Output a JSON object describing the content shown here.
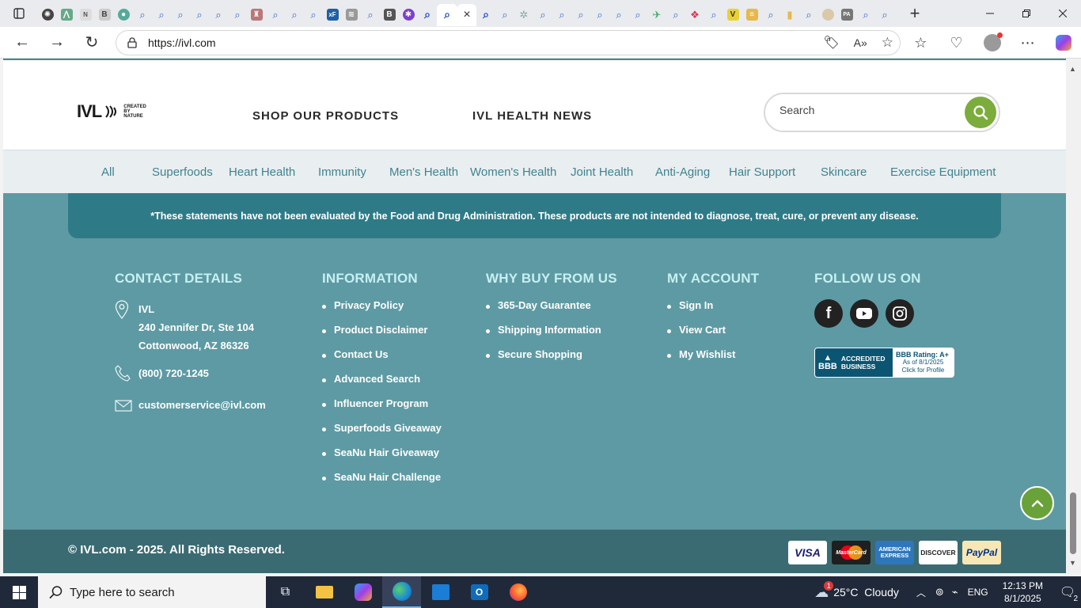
{
  "browser": {
    "url": "https://ivl.com",
    "new_tab_label": "+",
    "close_tab_label": "×",
    "tab_glyphs": [
      "N",
      "B",
      "xF",
      "B",
      "V",
      "PA"
    ]
  },
  "header": {
    "logo_main": "IVL",
    "logo_sub_1": "CREATED",
    "logo_sub_2": "BY",
    "logo_sub_3": "NATURE",
    "nav": [
      "SHOP OUR PRODUCTS",
      "IVL HEALTH NEWS"
    ],
    "search_placeholder": "Search"
  },
  "categories": [
    "All",
    "Superfoods",
    "Heart Health",
    "Immunity",
    "Men's Health",
    "Women's Health",
    "Joint Health",
    "Anti-Aging",
    "Hair Support",
    "Skincare",
    "Exercise Equipment"
  ],
  "footer": {
    "disclaimer": "*These statements have not been evaluated by the Food and Drug Administration. These products are not intended to diagnose, treat, cure, or prevent any disease.",
    "contact": {
      "title": "CONTACT DETAILS",
      "company": "IVL",
      "address_1": "240 Jennifer Dr, Ste 104",
      "address_2": "Cottonwood, AZ 86326",
      "phone": "(800) 720-1245",
      "email": "customerservice@ivl.com"
    },
    "information": {
      "title": "INFORMATION",
      "items": [
        "Privacy Policy",
        "Product Disclaimer",
        "Contact Us",
        "Advanced Search",
        "Influencer Program",
        "Superfoods Giveaway",
        "SeaNu Hair Giveaway",
        "SeaNu Hair Challenge"
      ]
    },
    "why_buy": {
      "title": "WHY BUY FROM US",
      "items": [
        "365-Day Guarantee",
        "Shipping Information",
        "Secure Shopping"
      ]
    },
    "account": {
      "title": "MY ACCOUNT",
      "items": [
        "Sign In",
        "View Cart",
        "My Wishlist"
      ]
    },
    "follow": {
      "title": "FOLLOW US ON",
      "bbb_left_1": "ACCREDITED",
      "bbb_left_2": "BUSINESS",
      "bbb_rating": "BBB Rating: A+",
      "bbb_date": "As of 8/1/2025",
      "bbb_click": "Click for Profile"
    },
    "copyright": "© IVL.com - 2025. All Rights Reserved.",
    "payments": [
      "VISA",
      "MasterCard",
      "AMERICAN EXPRESS",
      "DISCOVER",
      "PayPal"
    ]
  },
  "taskbar": {
    "search_placeholder": "Type here to search",
    "weather": "25°C  Cloudy",
    "weather_badge": "1",
    "language": "ENG",
    "time": "12:13 PM",
    "date": "8/1/2025",
    "notifications": "2"
  },
  "colors": {
    "footer_bg": "#5e9aa4",
    "disclaimer_bg": "#2e7b87",
    "bottom_bar_bg": "#3b6b72",
    "accent_green": "#7bac3c",
    "column_title": "#c6f0f2",
    "category_text": "#3f8390"
  }
}
